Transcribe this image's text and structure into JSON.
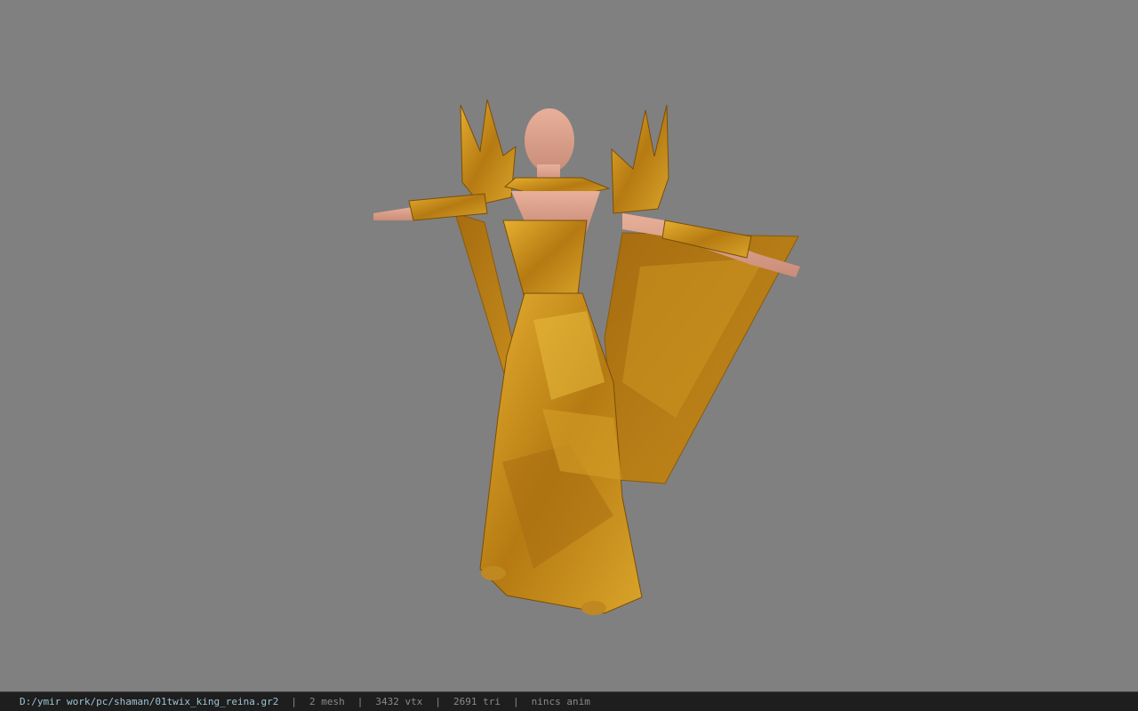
{
  "viewport": {
    "background": "#808080",
    "model": {
      "kind": "3d-character-model",
      "pose": "t-pose",
      "material_color": "#c8901e",
      "skin_color": "#e0a488"
    }
  },
  "statusbar": {
    "file_path": "D:/ymir work/pc/shaman/01twix_king_reina.gr2",
    "mesh_count": "2 mesh",
    "vertex_count": "3432 vtx",
    "triangle_count": "2691 tri",
    "anim": "nincs anim",
    "separator": "|",
    "path_color": "#9cc4d4",
    "text_color": "#8a8a8a"
  }
}
